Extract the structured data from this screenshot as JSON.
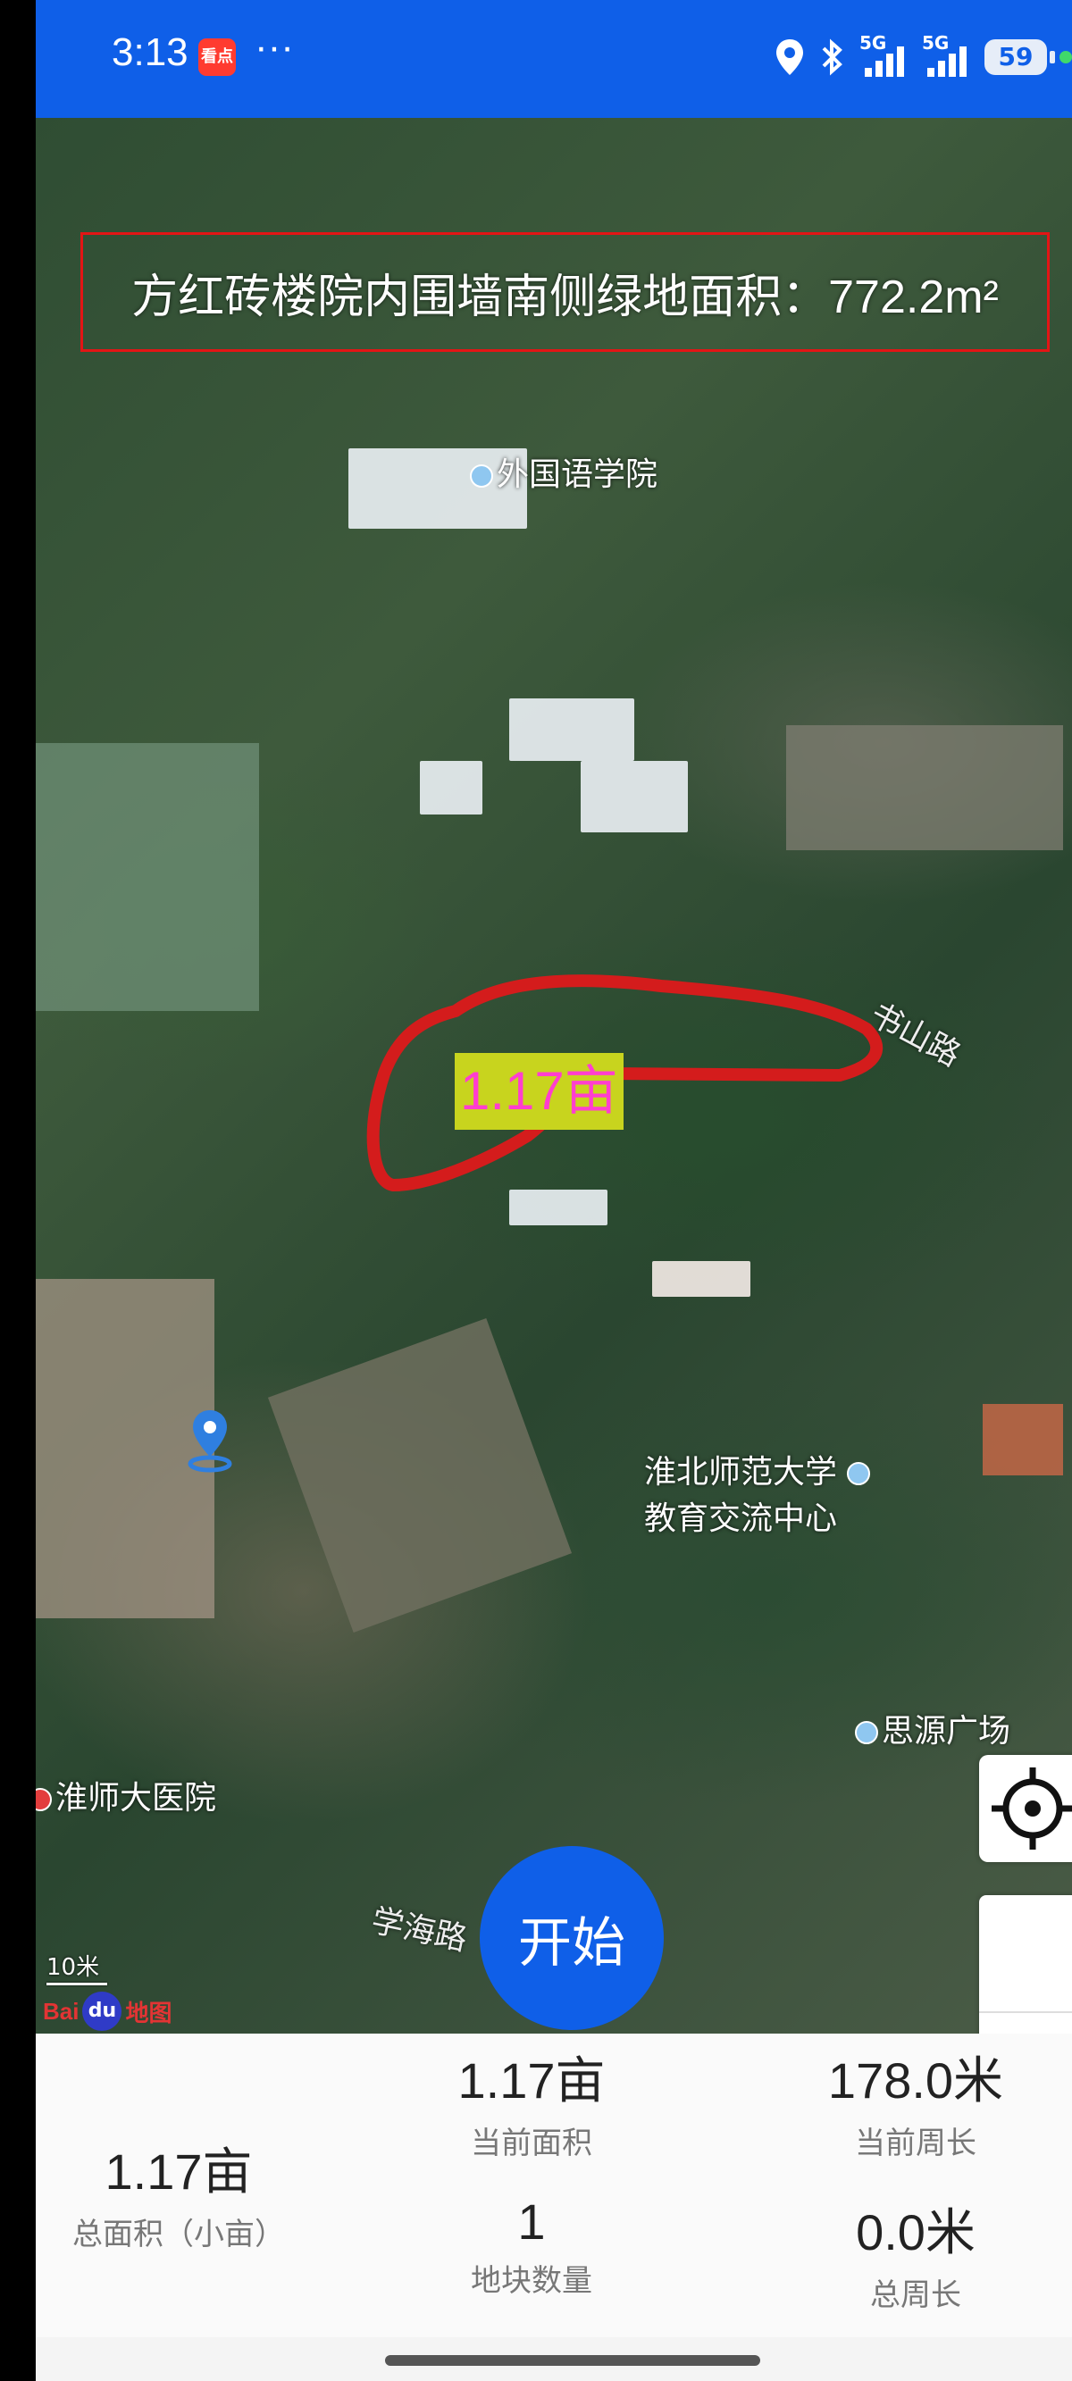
{
  "status_bar": {
    "time": "3:13",
    "news_icon_label": "看点",
    "more": "···",
    "signal_1": "5G",
    "signal_2": "5G",
    "battery": "59"
  },
  "map": {
    "title": "方红砖楼院内围墙南侧绿地面积：772.2m²",
    "area_label": "1.17亩",
    "pois": {
      "foreign_lang": "外国语学院",
      "exchange_center_line1": "淮北师范大学",
      "exchange_center_line2": "教育交流中心",
      "siyuan": "思源广场",
      "hospital": "淮师大医院"
    },
    "roads": {
      "shushan": "书山路",
      "xuehai": "学海路"
    },
    "scale": "10米",
    "baidu_text": "Bai",
    "baidu_paw": "du",
    "baidu_text2": "地图",
    "colors": {
      "outline": "#d41c1c",
      "label_bg": "#c8d41e",
      "label_text": "#ff3ecf"
    }
  },
  "start_button": "开始",
  "stats": {
    "total_area_value": "1.17亩",
    "total_area_label": "总面积（小亩）",
    "current_area_value": "1.17亩",
    "current_area_label": "当前面积",
    "current_perimeter_value": "178.0米",
    "current_perimeter_label": "当前周长",
    "plot_count_value": "1",
    "plot_count_label": "地块数量",
    "total_perimeter_value": "0.0米",
    "total_perimeter_label": "总周长"
  },
  "icons": [
    "location-pin-icon",
    "bluetooth-icon",
    "signal-icon",
    "battery-icon",
    "locate-icon",
    "zoom-out-icon",
    "user-location-icon"
  ],
  "accent_color": "#0f5fe8"
}
